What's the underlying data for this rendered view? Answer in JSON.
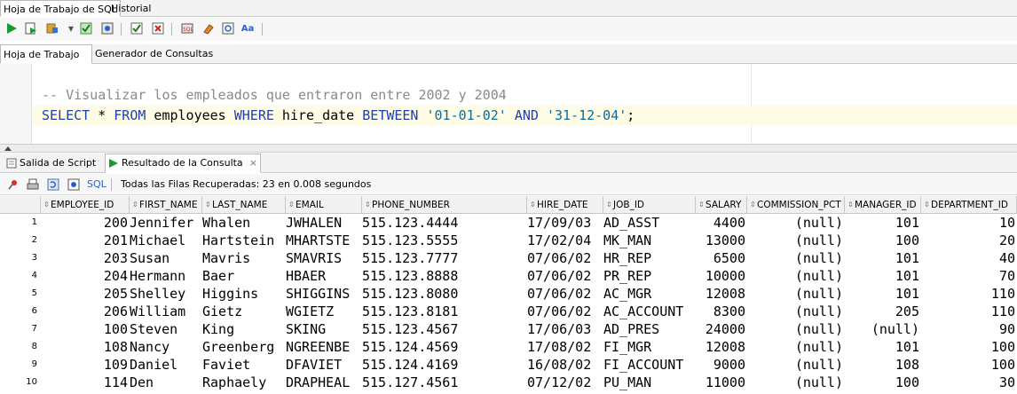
{
  "main_tabs": {
    "sql_sheet": "Hoja de Trabajo de SQL",
    "history": "Historial"
  },
  "sub_tabs": {
    "worksheet": "Hoja de Trabajo",
    "query_builder": "Generador de Consultas"
  },
  "editor": {
    "comment": "-- Visualizar los empleados que entraron entre 2002 y 2004",
    "line": {
      "k1": "SELECT",
      "p1": " * ",
      "k2": "FROM",
      "p2": " employees ",
      "k3": "WHERE",
      "p3": " hire_date ",
      "k4": "BETWEEN",
      "p4": " ",
      "s1": "'01-01-02'",
      "p5": " ",
      "k5": "AND",
      "p6": " ",
      "s2": "'31-12-04'",
      "p7": ";"
    }
  },
  "result_tabs": {
    "script_output": "Salida de Script",
    "query_result": "Resultado de la Consulta"
  },
  "result_toolbar": {
    "sql_label": "SQL",
    "status": "Todas las Filas Recuperadas: 23 en 0.008 segundos"
  },
  "grid": {
    "headers": [
      "EMPLOYEE_ID",
      "FIRST_NAME",
      "LAST_NAME",
      "EMAIL",
      "PHONE_NUMBER",
      "HIRE_DATE",
      "JOB_ID",
      "SALARY",
      "COMMISSION_PCT",
      "MANAGER_ID",
      "DEPARTMENT_ID"
    ],
    "rows": [
      [
        "1",
        "200",
        "Jennifer",
        "Whalen",
        "JWHALEN",
        "515.123.4444",
        "17/09/03",
        "AD_ASST",
        "4400",
        "(null)",
        "101",
        "10"
      ],
      [
        "2",
        "201",
        "Michael",
        "Hartstein",
        "MHARTSTE",
        "515.123.5555",
        "17/02/04",
        "MK_MAN",
        "13000",
        "(null)",
        "100",
        "20"
      ],
      [
        "3",
        "203",
        "Susan",
        "Mavris",
        "SMAVRIS",
        "515.123.7777",
        "07/06/02",
        "HR_REP",
        "6500",
        "(null)",
        "101",
        "40"
      ],
      [
        "4",
        "204",
        "Hermann",
        "Baer",
        "HBAER",
        "515.123.8888",
        "07/06/02",
        "PR_REP",
        "10000",
        "(null)",
        "101",
        "70"
      ],
      [
        "5",
        "205",
        "Shelley",
        "Higgins",
        "SHIGGINS",
        "515.123.8080",
        "07/06/02",
        "AC_MGR",
        "12008",
        "(null)",
        "101",
        "110"
      ],
      [
        "6",
        "206",
        "William",
        "Gietz",
        "WGIETZ",
        "515.123.8181",
        "07/06/02",
        "AC_ACCOUNT",
        "8300",
        "(null)",
        "205",
        "110"
      ],
      [
        "7",
        "100",
        "Steven",
        "King",
        "SKING",
        "515.123.4567",
        "17/06/03",
        "AD_PRES",
        "24000",
        "(null)",
        "(null)",
        "90"
      ],
      [
        "8",
        "108",
        "Nancy",
        "Greenberg",
        "NGREENBE",
        "515.124.4569",
        "17/08/02",
        "FI_MGR",
        "12008",
        "(null)",
        "101",
        "100"
      ],
      [
        "9",
        "109",
        "Daniel",
        "Faviet",
        "DFAVIET",
        "515.124.4169",
        "16/08/02",
        "FI_ACCOUNT",
        "9000",
        "(null)",
        "108",
        "100"
      ],
      [
        "10",
        "114",
        "Den",
        "Raphaely",
        "DRAPHEAL",
        "515.127.4561",
        "07/12/02",
        "PU_MAN",
        "11000",
        "(null)",
        "100",
        "30"
      ]
    ]
  }
}
